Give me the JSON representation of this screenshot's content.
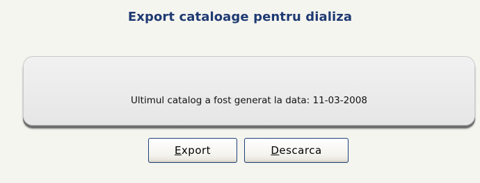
{
  "page": {
    "title": "Export cataloage pentru dializa"
  },
  "panel": {
    "message": "Ultimul catalog a fost generat la data: 11-03-2008"
  },
  "buttons": {
    "export": {
      "accel": "E",
      "rest": "xport",
      "label": "Export"
    },
    "descarca": {
      "accel": "D",
      "rest": "escarca",
      "label": "Descarca"
    }
  },
  "colors": {
    "title": "#1f3a73",
    "background": "#f5f5ef",
    "button_border": "#1c3f7a"
  }
}
